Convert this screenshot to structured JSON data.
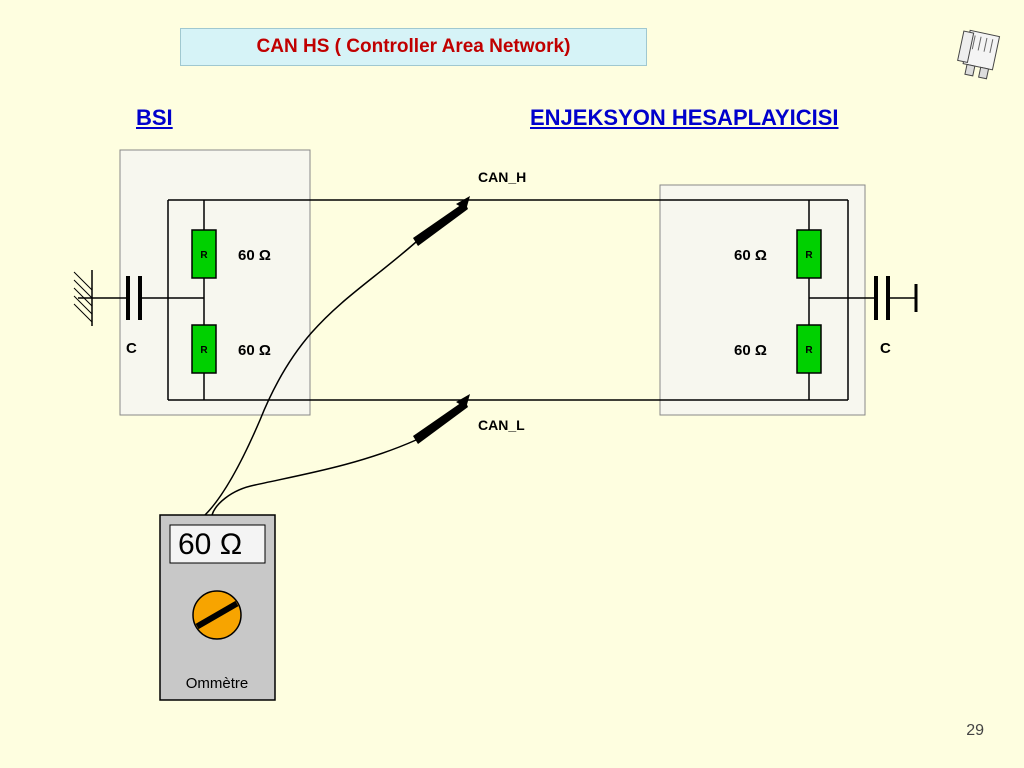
{
  "title": "CAN HS ( Controller Area Network)",
  "header_left": "BSI",
  "header_right": "ENJEKSYON HESAPLAYICISI",
  "bus": {
    "high": "CAN_H",
    "low": "CAN_L"
  },
  "resistors": {
    "left_top": "60 Ω",
    "left_bottom": "60 Ω",
    "right_top": "60 Ω",
    "right_bottom": "60 Ω",
    "symbol": "R"
  },
  "capacitor_label": "C",
  "meter": {
    "reading": "60 Ω",
    "label": "Ommètre"
  },
  "page_number": "29"
}
